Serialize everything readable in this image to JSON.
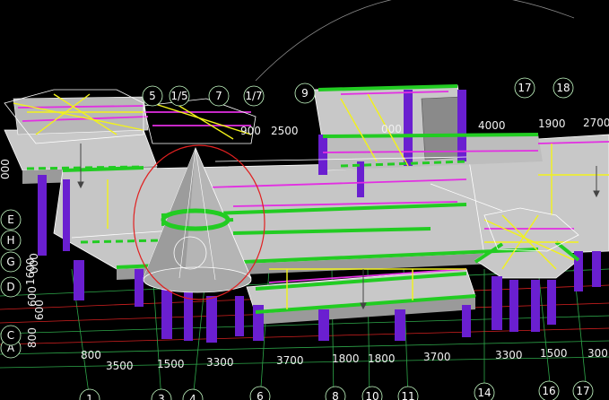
{
  "app": {
    "view_name": "3D structural model viewport"
  },
  "colors": {
    "background": "#000000",
    "slab": "#c8c8c8",
    "slab_side": "#9a9a9a",
    "column": "#6a1fd0",
    "beam_green": "#22cc22",
    "beam_magenta": "#e22ee2",
    "rebar_yellow": "#f2f21a",
    "wire_white": "#ffffff",
    "grid_green": "#2ea84a",
    "grid_red": "#d42020",
    "axis_bubble": "#c8ffc8",
    "selection_circle": "#e02020"
  },
  "grid_axes": {
    "top": [
      {
        "label": "5"
      },
      {
        "label": "1/5"
      },
      {
        "label": "7"
      },
      {
        "label": "1/7"
      },
      {
        "label": "9"
      },
      {
        "label": "17"
      },
      {
        "label": "18"
      }
    ],
    "bottom": [
      {
        "label": "1"
      },
      {
        "label": "3"
      },
      {
        "label": "4"
      },
      {
        "label": "6"
      },
      {
        "label": "8"
      },
      {
        "label": "10"
      },
      {
        "label": "11"
      },
      {
        "label": "14"
      },
      {
        "label": "16"
      },
      {
        "label": "17"
      }
    ],
    "left": [
      {
        "label": "A"
      },
      {
        "label": "C"
      },
      {
        "label": "D"
      },
      {
        "label": "G"
      },
      {
        "label": "H"
      },
      {
        "label": "E"
      }
    ]
  },
  "dimensions": {
    "bottom": [
      {
        "text": "800"
      },
      {
        "text": "3500"
      },
      {
        "text": "1500"
      },
      {
        "text": "3300"
      },
      {
        "text": "3700"
      },
      {
        "text": "1800"
      },
      {
        "text": "1800"
      },
      {
        "text": "3700"
      },
      {
        "text": "3300"
      },
      {
        "text": "1500"
      },
      {
        "text": "300"
      }
    ],
    "top": [
      {
        "text": "2500"
      },
      {
        "text": "000"
      },
      {
        "text": "4000"
      },
      {
        "text": "1900"
      },
      {
        "text": "2700"
      },
      {
        "text": "900"
      }
    ],
    "left": [
      {
        "text": "800"
      },
      {
        "text": "600"
      },
      {
        "text": "600"
      },
      {
        "text": "1600"
      },
      {
        "text": "000"
      },
      {
        "text": "000"
      }
    ]
  }
}
